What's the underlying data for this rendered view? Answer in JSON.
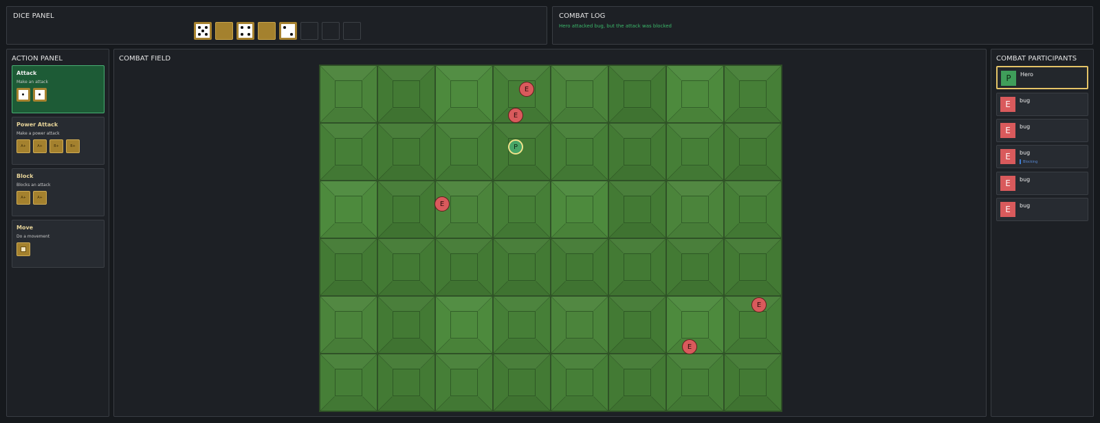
{
  "dice_panel": {
    "title": "DICE PANEL",
    "dice": [
      {
        "kind": "face",
        "value": 5
      },
      {
        "kind": "gold"
      },
      {
        "kind": "face",
        "value": 4
      },
      {
        "kind": "gold"
      },
      {
        "kind": "face",
        "value": 2
      },
      {
        "kind": "empty"
      },
      {
        "kind": "empty"
      },
      {
        "kind": "empty"
      }
    ]
  },
  "combat_log": {
    "title": "COMBAT LOG",
    "entries": [
      "Hero attacked bug, but the attack was blocked"
    ]
  },
  "action_panel": {
    "title": "ACTION PANEL",
    "actions": [
      {
        "name": "Attack",
        "desc": "Make an attack",
        "costs": [
          "",
          ""
        ],
        "selected": true
      },
      {
        "name": "Power Attack",
        "desc": "Make a power attack",
        "costs": [
          "A+",
          "A+",
          "B+",
          "B+"
        ],
        "selected": false
      },
      {
        "name": "Block",
        "desc": "Blocks an attack",
        "costs": [
          "A+",
          "A+"
        ],
        "selected": false
      },
      {
        "name": "Move",
        "desc": "Do a movement",
        "costs": [
          "move"
        ],
        "selected": false
      }
    ]
  },
  "combat_field": {
    "title": "COMBAT FIELD",
    "grid": {
      "cols": 8,
      "rows": 6
    },
    "tokens": [
      {
        "label": "E",
        "type": "enemy"
      },
      {
        "label": "E",
        "type": "enemy"
      },
      {
        "label": "P",
        "type": "player"
      },
      {
        "label": "E",
        "type": "enemy"
      },
      {
        "label": "E",
        "type": "enemy"
      },
      {
        "label": "E",
        "type": "enemy"
      }
    ]
  },
  "participants": {
    "title": "COMBAT PARTICIPANTS",
    "list": [
      {
        "avatar": "P",
        "name": "Hero",
        "type": "player",
        "active": true,
        "status": ""
      },
      {
        "avatar": "E",
        "name": "bug",
        "type": "enemy",
        "active": false,
        "status": ""
      },
      {
        "avatar": "E",
        "name": "bug",
        "type": "enemy",
        "active": false,
        "status": ""
      },
      {
        "avatar": "E",
        "name": "bug",
        "type": "enemy",
        "active": false,
        "status": "Blocking"
      },
      {
        "avatar": "E",
        "name": "bug",
        "type": "enemy",
        "active": false,
        "status": ""
      },
      {
        "avatar": "E",
        "name": "bug",
        "type": "enemy",
        "active": false,
        "status": ""
      }
    ]
  },
  "colors": {
    "selected_action": "#1d5b36",
    "log_text": "#3bb86a",
    "enemy": "#d95a5c",
    "player": "#48a566",
    "active_outline": "#e6c568",
    "die_gold": "#a4812e"
  }
}
